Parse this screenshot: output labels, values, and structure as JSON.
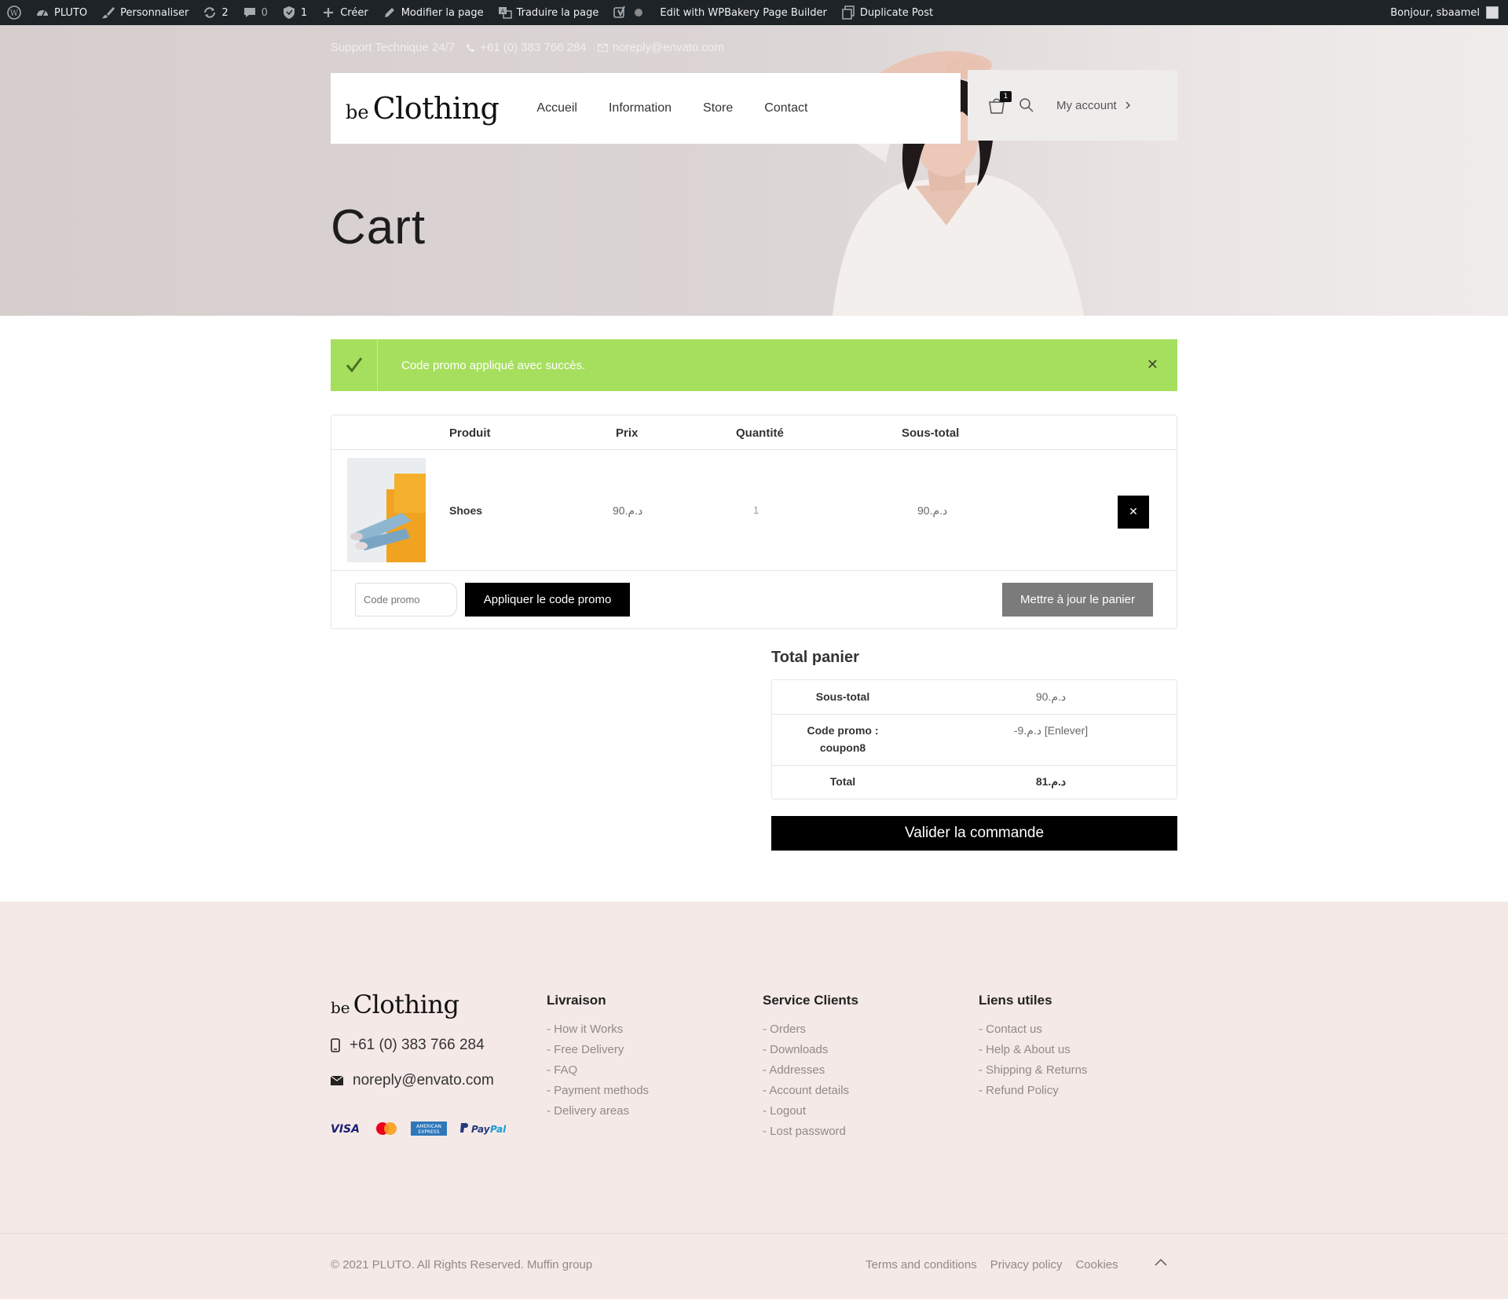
{
  "adminbar": {
    "site": "PLUTO",
    "customize": "Personnaliser",
    "updates": "2",
    "comments": "0",
    "shield_count": "1",
    "create": "Créer",
    "edit_page": "Modifier la page",
    "translate": "Traduire la page",
    "wpbakery": "Edit with WPBakery Page Builder",
    "duplicate": "Duplicate Post",
    "greeting": "Bonjour, sbaamel"
  },
  "topinfo": {
    "support": "Support Technique 24/7",
    "phone": "+61 (0) 383 766 284",
    "email": "noreply@envato.com"
  },
  "header": {
    "logo_small": "be",
    "logo_big": "Clothing",
    "nav": [
      "Accueil",
      "Information",
      "Store",
      "Contact"
    ],
    "cart_count": "1",
    "my_account": "My account"
  },
  "hero": {
    "title": "Cart"
  },
  "notice": {
    "text": "Code promo appliqué avec succès.",
    "color": "#a6df5d"
  },
  "cart": {
    "headers": {
      "product": "Produit",
      "price": "Prix",
      "quantity": "Quantité",
      "subtotal": "Sous-total"
    },
    "items": [
      {
        "name": "Shoes",
        "price": "90.د.م",
        "quantity": "1",
        "subtotal": "90.د.م"
      }
    ],
    "coupon_placeholder": "Code promo",
    "apply_label": "Appliquer le code promo",
    "update_label": "Mettre à jour le panier"
  },
  "totals": {
    "title": "Total panier",
    "subtotal_label": "Sous-total",
    "subtotal_value": "90.د.م",
    "coupon_label_1": "Code promo :",
    "coupon_label_2": "coupon8",
    "coupon_value": "-9.د.م",
    "coupon_remove": "[Enlever]",
    "total_label": "Total",
    "total_value": "81.د.م",
    "checkout_label": "Valider la commande"
  },
  "footer": {
    "logo_small": "be",
    "logo_big": "Clothing",
    "phone": "+61 (0) 383 766 284",
    "email": "noreply@envato.com",
    "columns": [
      {
        "title": "Livraison",
        "links": [
          "- How it Works",
          "- Free Delivery",
          "- FAQ",
          "- Payment methods",
          "- Delivery areas"
        ]
      },
      {
        "title": "Service Clients",
        "links": [
          "- Orders",
          "- Downloads",
          "- Addresses",
          "- Account details",
          "- Logout",
          "- Lost password"
        ]
      },
      {
        "title": "Liens utiles",
        "links": [
          "- Contact us",
          "- Help & About us",
          "- Shipping & Returns",
          "- Refund Policy"
        ]
      }
    ],
    "payments": {
      "visa": "VISA",
      "amex_1": "AMERICAN",
      "amex_2": "EXPRESS",
      "paypal_1": "Pay",
      "paypal_2": "Pal"
    },
    "copyright": "© 2021 PLUTO. All Rights Reserved. Muffin group",
    "bottom_links": [
      "Terms and conditions",
      "Privacy policy",
      "Cookies"
    ]
  }
}
